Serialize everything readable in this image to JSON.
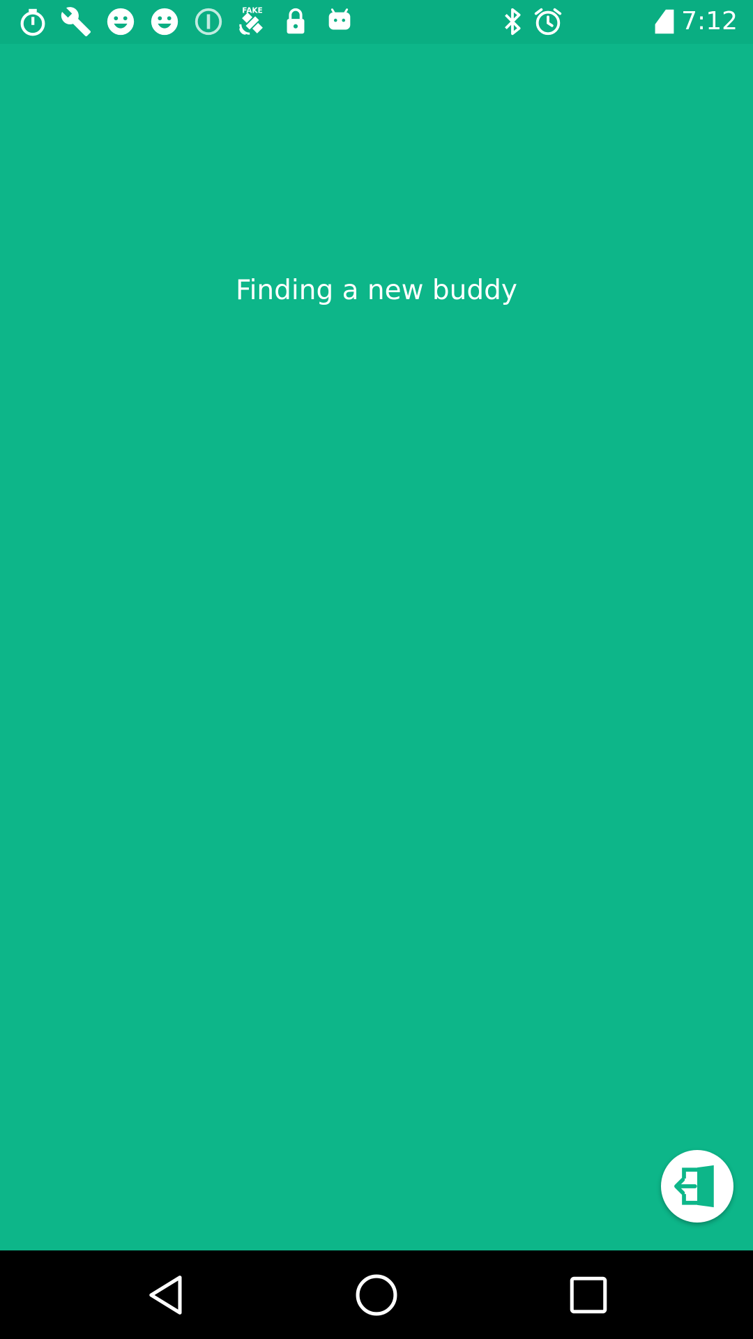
{
  "status_bar": {
    "time": "7:12",
    "left_icons": [
      "stopwatch-icon",
      "wrench-icon",
      "smiley-icon",
      "smiley-icon",
      "info-circle-icon",
      "fake-gps-satellite-icon",
      "lock-icon",
      "android-icon"
    ],
    "right_icons": [
      "bluetooth-icon",
      "alarm-icon",
      "signal-icon"
    ],
    "fake_badge": "FAKE"
  },
  "main": {
    "message": "Finding a new buddy",
    "background_color": "#0db689"
  },
  "exit_button": {
    "icon": "exit-door-icon",
    "icon_color": "#0db689"
  },
  "nav_bar": {
    "buttons": [
      "back-triangle-icon",
      "home-circle-icon",
      "recents-square-icon"
    ]
  }
}
